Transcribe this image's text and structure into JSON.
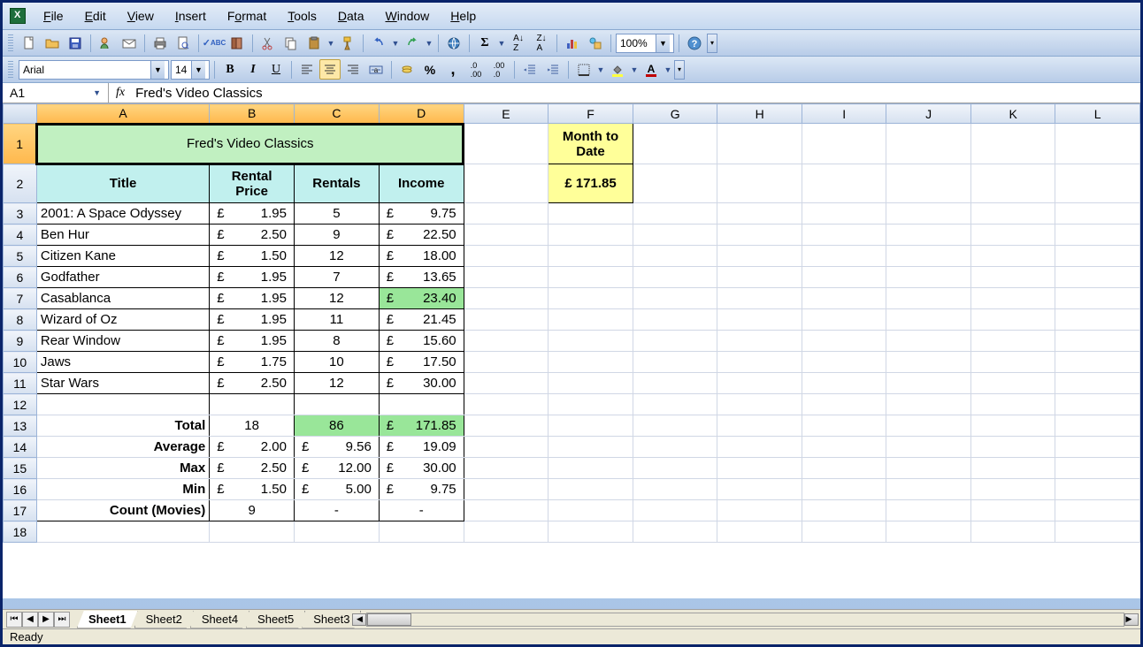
{
  "menu": {
    "file": "File",
    "edit": "Edit",
    "view": "View",
    "insert": "Insert",
    "format": "Format",
    "tools": "Tools",
    "data": "Data",
    "window": "Window",
    "help": "Help"
  },
  "toolbar": {
    "font": "Arial",
    "size": "14",
    "zoom": "100%"
  },
  "namebox": "A1",
  "fx": "fx",
  "formula": "Fred's Video Classics",
  "cols": [
    "A",
    "B",
    "C",
    "D",
    "E",
    "F",
    "G",
    "H",
    "I",
    "J",
    "K",
    "L"
  ],
  "title": "Fred's Video Classics",
  "headers": {
    "title": "Title",
    "price": "Rental Price",
    "rentals": "Rentals",
    "income": "Income"
  },
  "mtd": {
    "label": "Month to Date",
    "value": "£ 171.85"
  },
  "rows": [
    {
      "r": 3,
      "title": "2001: A Space Odyssey",
      "price": "1.95",
      "rentals": "5",
      "income": "9.75"
    },
    {
      "r": 4,
      "title": "Ben Hur",
      "price": "2.50",
      "rentals": "9",
      "income": "22.50"
    },
    {
      "r": 5,
      "title": "Citizen Kane",
      "price": "1.50",
      "rentals": "12",
      "income": "18.00"
    },
    {
      "r": 6,
      "title": "Godfather",
      "price": "1.95",
      "rentals": "7",
      "income": "13.65"
    },
    {
      "r": 7,
      "title": "Casablanca",
      "price": "1.95",
      "rentals": "12",
      "income": "23.40",
      "hl": true
    },
    {
      "r": 8,
      "title": "Wizard of Oz",
      "price": "1.95",
      "rentals": "11",
      "income": "21.45"
    },
    {
      "r": 9,
      "title": "Rear Window",
      "price": "1.95",
      "rentals": "8",
      "income": "15.60"
    },
    {
      "r": 10,
      "title": "Jaws",
      "price": "1.75",
      "rentals": "10",
      "income": "17.50"
    },
    {
      "r": 11,
      "title": "Star Wars",
      "price": "2.50",
      "rentals": "12",
      "income": "30.00"
    }
  ],
  "summary": [
    {
      "r": 13,
      "label": "Total",
      "b": "18",
      "c": "86",
      "d": "171.85",
      "bhl": false,
      "chl": true,
      "dhl": true
    },
    {
      "r": 14,
      "label": "Average",
      "b": "2.00",
      "c": "9.56",
      "d": "19.09",
      "money": true
    },
    {
      "r": 15,
      "label": "Max",
      "b": "2.50",
      "c": "12.00",
      "d": "30.00",
      "money": true
    },
    {
      "r": 16,
      "label": "Min",
      "b": "1.50",
      "c": "5.00",
      "d": "9.75",
      "money": true
    },
    {
      "r": 17,
      "label": "Count (Movies)",
      "b": "9",
      "c": "-",
      "d": "-"
    }
  ],
  "sheets": [
    "Sheet1",
    "Sheet2",
    "Sheet4",
    "Sheet5",
    "Sheet3"
  ],
  "status": "Ready",
  "currency": "£"
}
